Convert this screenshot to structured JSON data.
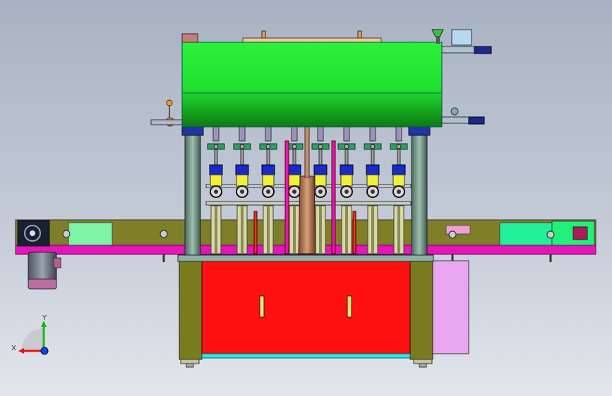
{
  "viewport": {
    "background_top": "#a9b2c2",
    "background_bottom": "#e2e6ec"
  },
  "model": {
    "tank_color": "#22ee33",
    "cabinet_color": "#ff1111",
    "conveyor_color": "#e316b7",
    "frame_color": "#7a7a1e",
    "side_panel_color": "#e8a6f0",
    "valve_head_color": "#1a2ac8",
    "valve_body_color": "#f2ee3a",
    "nozzle_count": 8
  },
  "triad": {
    "x_label": "X",
    "y_label": "Y",
    "x_color": "#ee1111",
    "y_color": "#11bb11",
    "z_color": "#1144ee"
  }
}
